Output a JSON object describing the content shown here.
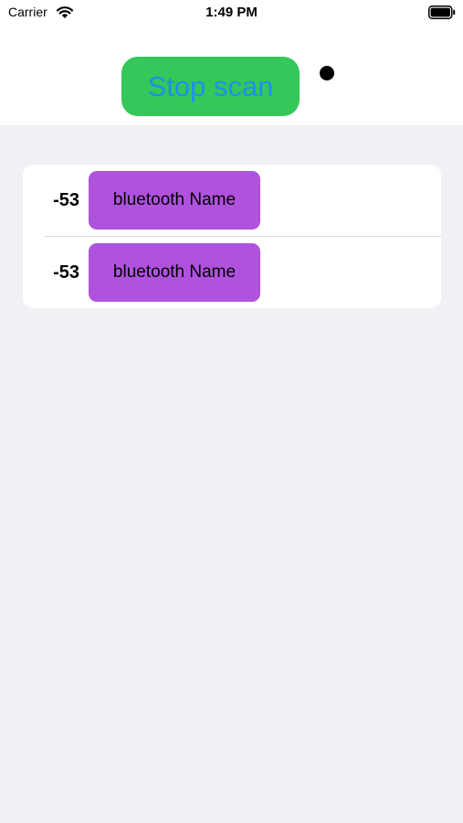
{
  "status_bar": {
    "carrier": "Carrier",
    "time": "1:49 PM",
    "wifi_icon": "wifi-icon",
    "battery_icon": "battery-icon"
  },
  "scan": {
    "button_label": "Stop scan",
    "button_color": "#34c759",
    "label_color": "#1e8ff0",
    "indicator_color": "#000000"
  },
  "devices": [
    {
      "rssi": "-53",
      "name": "bluetooth Name"
    },
    {
      "rssi": "-53",
      "name": "bluetooth Name"
    }
  ],
  "colors": {
    "background": "#f0f0f5",
    "device_button": "#af52de"
  }
}
